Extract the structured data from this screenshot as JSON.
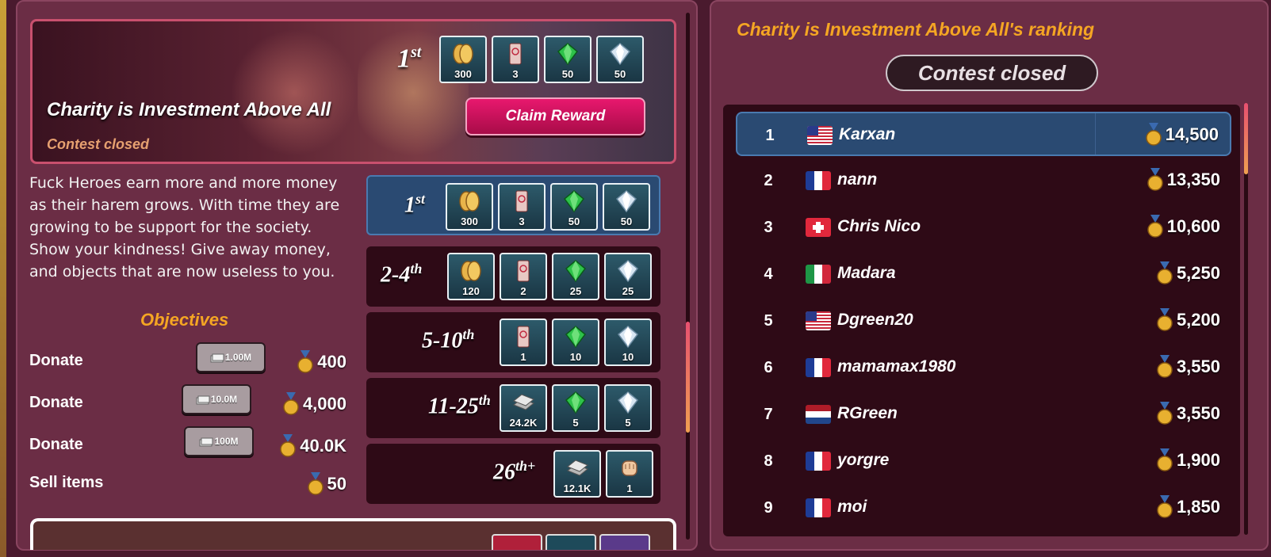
{
  "contest": {
    "title": "Charity is Investment Above All",
    "status": "Contest closed",
    "top_rank_label": "1",
    "top_rank_suffix": "st",
    "claim_label": "Claim Reward",
    "description": "Fuck Heroes earn more and more money as their harem grows. With time they are growing to be support for the society. Show your kindness! Give away money, and objects that are now useless to you.",
    "banner_rewards": [
      {
        "icon": "coin-stack-icon",
        "qty": "300"
      },
      {
        "icon": "ticket-icon",
        "qty": "3"
      },
      {
        "icon": "green-gem-icon",
        "qty": "50"
      },
      {
        "icon": "white-gem-icon",
        "qty": "50"
      }
    ]
  },
  "objectives": {
    "title": "Objectives",
    "items": [
      {
        "label": "Donate",
        "amount": "1.00M",
        "points": "400"
      },
      {
        "label": "Donate",
        "amount": "10.0M",
        "points": "4,000"
      },
      {
        "label": "Donate",
        "amount": "100M",
        "points": "40.0K"
      },
      {
        "label": "Sell items",
        "amount": "",
        "points": "50"
      }
    ]
  },
  "tiers": [
    {
      "label": "1",
      "suffix": "st",
      "rewards": [
        {
          "icon": "coin-stack-icon",
          "qty": "300"
        },
        {
          "icon": "ticket-icon",
          "qty": "3"
        },
        {
          "icon": "green-gem-icon",
          "qty": "50"
        },
        {
          "icon": "white-gem-icon",
          "qty": "50"
        }
      ]
    },
    {
      "label": "2-4",
      "suffix": "th",
      "rewards": [
        {
          "icon": "coin-stack-icon",
          "qty": "120"
        },
        {
          "icon": "ticket-icon",
          "qty": "2"
        },
        {
          "icon": "green-gem-icon",
          "qty": "25"
        },
        {
          "icon": "white-gem-icon",
          "qty": "25"
        }
      ]
    },
    {
      "label": "5-10",
      "suffix": "th",
      "rewards": [
        {
          "icon": "ticket-icon",
          "qty": "1"
        },
        {
          "icon": "green-gem-icon",
          "qty": "10"
        },
        {
          "icon": "white-gem-icon",
          "qty": "10"
        }
      ]
    },
    {
      "label": "11-25",
      "suffix": "th",
      "rewards": [
        {
          "icon": "money-stack-icon",
          "qty": "24.2K"
        },
        {
          "icon": "green-gem-icon",
          "qty": "5"
        },
        {
          "icon": "white-gem-icon",
          "qty": "5"
        }
      ]
    },
    {
      "label": "26",
      "suffix": "th+",
      "rewards": [
        {
          "icon": "money-stack-icon",
          "qty": "12.1K"
        },
        {
          "icon": "fist-icon",
          "qty": "1"
        }
      ]
    }
  ],
  "ranking": {
    "title": "Charity is Investment Above All's ranking",
    "status": "Contest closed",
    "rows": [
      {
        "rank": "1",
        "flag": "us",
        "name": "Karxan",
        "score": "14,500"
      },
      {
        "rank": "2",
        "flag": "fr",
        "name": "nann",
        "score": "13,350"
      },
      {
        "rank": "3",
        "flag": "ch",
        "name": "Chris Nico",
        "score": "10,600"
      },
      {
        "rank": "4",
        "flag": "it",
        "name": "Madara",
        "score": "5,250"
      },
      {
        "rank": "5",
        "flag": "us",
        "name": "Dgreen20",
        "score": "5,200"
      },
      {
        "rank": "6",
        "flag": "fr",
        "name": "mamamax1980",
        "score": "3,550"
      },
      {
        "rank": "7",
        "flag": "nl",
        "name": "RGreen",
        "score": "3,550"
      },
      {
        "rank": "8",
        "flag": "fr",
        "name": "yorgre",
        "score": "1,900"
      },
      {
        "rank": "9",
        "flag": "fr",
        "name": "moi",
        "score": "1,850"
      }
    ]
  },
  "colors": {
    "accent": "#f5a623",
    "claim": "#e8186e",
    "active_row": "#2a4a72"
  }
}
